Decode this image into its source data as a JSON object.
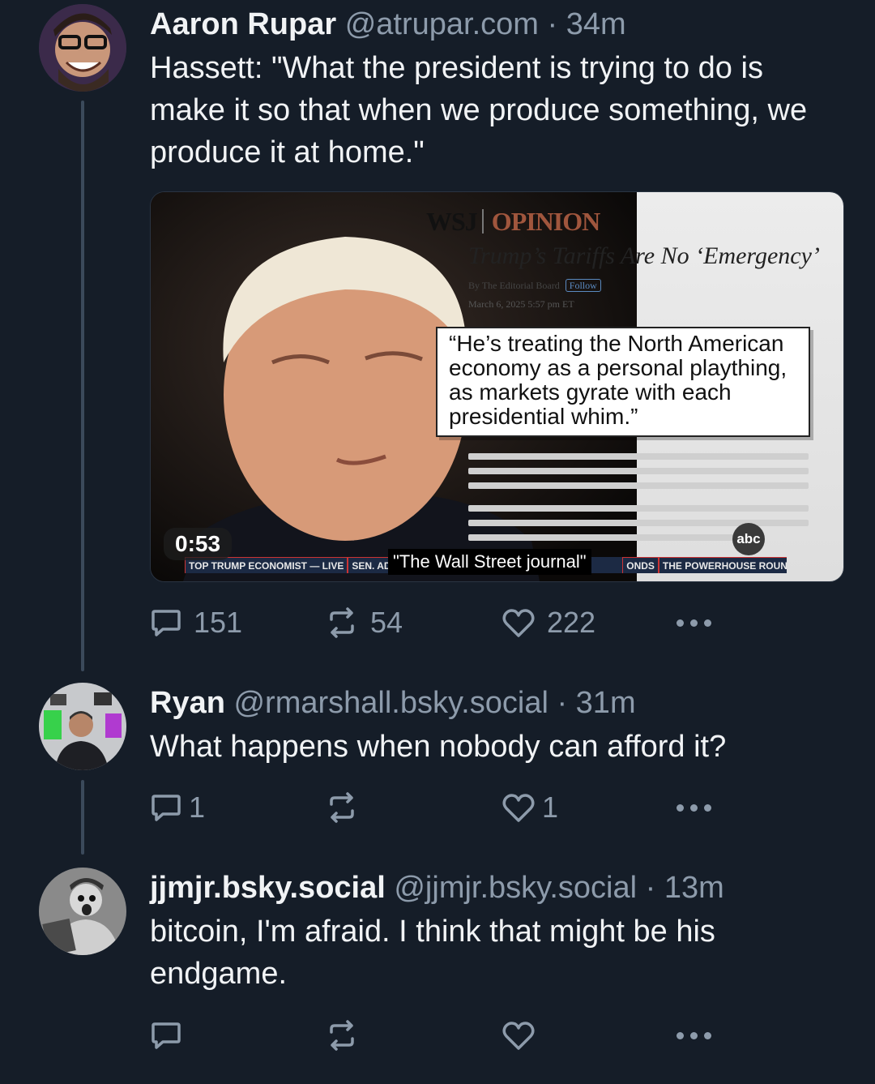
{
  "posts": [
    {
      "name": "Aaron Rupar",
      "handle": "@atrupar.com",
      "dot": "·",
      "time": "34m",
      "text": "Hassett: \"What the president is trying to do is make it so that when we produce something, we produce it at home.\"",
      "video": {
        "duration": "0:53",
        "paper_brand": "WSJ",
        "paper_section": "OPINION",
        "headline": "Trump’s Tariffs Are No ‘Emergency’",
        "byline": "By The Editorial Board",
        "follow_label": "Follow",
        "date": "March 6, 2025 5:57 pm ET",
        "quote": "“He’s treating the North American economy as a personal plaything, as markets gyrate with each presidential whim.”",
        "caption": "\"The Wall Street journal\"",
        "ticker": [
          "TOP TRUMP ECONOMIST — LIVE",
          "SEN. ADAM",
          "ONDS",
          "THE POWERHOUSE ROUNDTABLE"
        ],
        "network_logo": "abc"
      },
      "replies": "151",
      "reposts": "54",
      "likes": "222"
    },
    {
      "name": "Ryan",
      "handle": "@rmarshall.bsky.social",
      "dot": "·",
      "time": "31m",
      "text": "What happens when nobody can afford it?",
      "replies": "1",
      "reposts": "",
      "likes": "1"
    },
    {
      "name": "jjmjr.bsky.social",
      "handle": "@jjmjr.bsky.social",
      "dot": "·",
      "time": "13m",
      "text": "bitcoin, I'm afraid.  I think that  might be his endgame.",
      "replies": "",
      "reposts": "",
      "likes": ""
    }
  ],
  "colors": {
    "background": "#151d28",
    "muted": "#8d9bab",
    "text": "#f1f3f5",
    "thread_line": "#3b4a5b"
  },
  "icons": [
    "reply-icon",
    "repost-icon",
    "like-icon",
    "more-icon"
  ]
}
